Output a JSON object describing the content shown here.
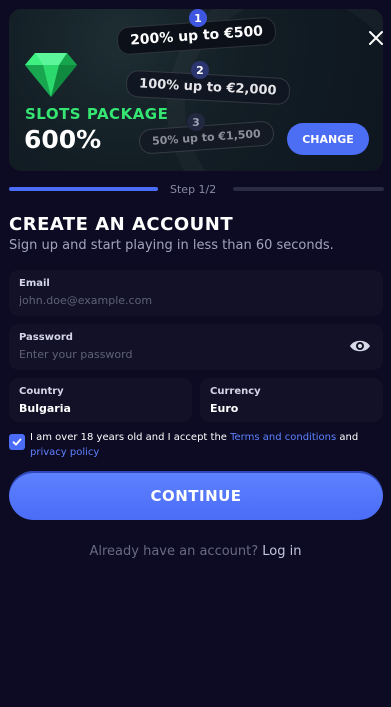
{
  "banner": {
    "offers": [
      {
        "badge": "1",
        "text": "200% up to €500"
      },
      {
        "badge": "2",
        "text": "100% up to €2,000"
      },
      {
        "badge": "3",
        "text": "50% up to €1,500"
      }
    ],
    "package_label": "SLOTS PACKAGE",
    "package_percent": "600%",
    "change_label": "CHANGE"
  },
  "step": {
    "text": "Step 1/2"
  },
  "form": {
    "title": "CREATE AN ACCOUNT",
    "subtitle": "Sign up and start playing in less than 60 seconds.",
    "email": {
      "label": "Email",
      "placeholder": "john.doe@example.com"
    },
    "password": {
      "label": "Password",
      "placeholder": "Enter your password"
    },
    "country": {
      "label": "Country",
      "value": "Bulgaria"
    },
    "currency": {
      "label": "Currency",
      "value": "Euro"
    },
    "terms": {
      "prefix": "I am over 18 years old and I accept the ",
      "terms_link": "Terms and conditions",
      "middle": " and ",
      "privacy_link": "privacy policy"
    },
    "continue_label": "CONTINUE",
    "login_prompt": "Already have an account?",
    "login_link": "Log in"
  },
  "colors": {
    "background": "#0c0b23",
    "accent": "#4a6cf7",
    "package_green": "#35e673"
  },
  "icons": {
    "close": "close-icon",
    "gem": "emerald-gem-icon",
    "eye": "eye-icon",
    "check": "checkmark-icon"
  }
}
